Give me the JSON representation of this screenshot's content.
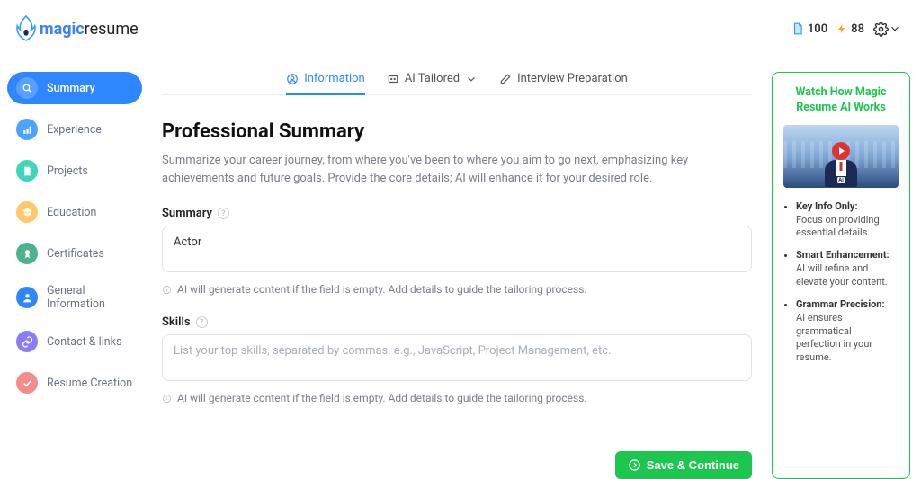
{
  "header": {
    "logo_part1": "magic",
    "logo_part2": "resume",
    "credits_doc": "100",
    "credits_bolt": "88"
  },
  "sidebar": {
    "items": [
      {
        "label": "Summary"
      },
      {
        "label": "Experience"
      },
      {
        "label": "Projects"
      },
      {
        "label": "Education"
      },
      {
        "label": "Certificates"
      },
      {
        "label": "General Information"
      },
      {
        "label": "Contact & links"
      },
      {
        "label": "Resume Creation"
      }
    ]
  },
  "tabs": {
    "information": "Information",
    "ai_tailored": "AI Tailored",
    "interview": "Interview Preparation"
  },
  "section": {
    "title": "Professional Summary",
    "description": "Summarize your career journey, from where you've been to where you aim to go next, emphasizing key achievements and future goals. Provide the core details; AI will enhance it for your desired role.",
    "summary_label": "Summary",
    "summary_value": "Actor",
    "summary_hint": "AI will generate content if the field is empty. Add details to guide the tailoring process.",
    "skills_label": "Skills",
    "skills_placeholder": "List your top skills, separated by commas. e.g., JavaScript, Project Management, etc.",
    "skills_hint": "AI will generate content if the field is empty. Add details to guide the tailoring process.",
    "save_button": "Save & Continue"
  },
  "right_panel": {
    "title": "Watch How Magic Resume AI Works",
    "ai_badge": "AI",
    "tips": [
      {
        "title": "Key Info Only:",
        "body": "Focus on providing essential details."
      },
      {
        "title": "Smart Enhancement:",
        "body": "AI will refine and elevate your content."
      },
      {
        "title": "Grammar Precision:",
        "body": "AI ensures grammatical perfection in your resume."
      }
    ]
  }
}
